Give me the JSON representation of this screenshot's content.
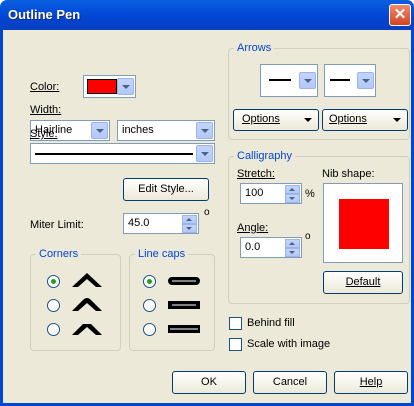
{
  "window": {
    "title": "Outline Pen",
    "close_glyph": "✕"
  },
  "color": {
    "label": "Color:",
    "swatch": "#ff0000"
  },
  "width": {
    "label": "Width:",
    "value": "Hairline",
    "unit": "inches"
  },
  "style": {
    "label": "Style:",
    "edit_button": "Edit Style..."
  },
  "miter": {
    "label": "Miter Limit:",
    "value": "45.0",
    "degree": "o"
  },
  "corners": {
    "title": "Corners",
    "selected": 0
  },
  "line_caps": {
    "title": "Line caps",
    "selected": 0
  },
  "arrows": {
    "title": "Arrows",
    "options_left": "Options",
    "options_right": "Options"
  },
  "calligraphy": {
    "title": "Calligraphy",
    "stretch_label": "Stretch:",
    "stretch_value": "100",
    "percent": "%",
    "angle_label": "Angle:",
    "angle_value": "0.0",
    "degree": "o",
    "nib_label": "Nib shape:",
    "nib_color": "#ff0000",
    "default_button": "Default"
  },
  "behind_fill": {
    "label": "Behind fill",
    "checked": false
  },
  "scale_image": {
    "label": "Scale with image",
    "checked": false
  },
  "footer": {
    "ok": "OK",
    "cancel": "Cancel",
    "help": "Help"
  }
}
